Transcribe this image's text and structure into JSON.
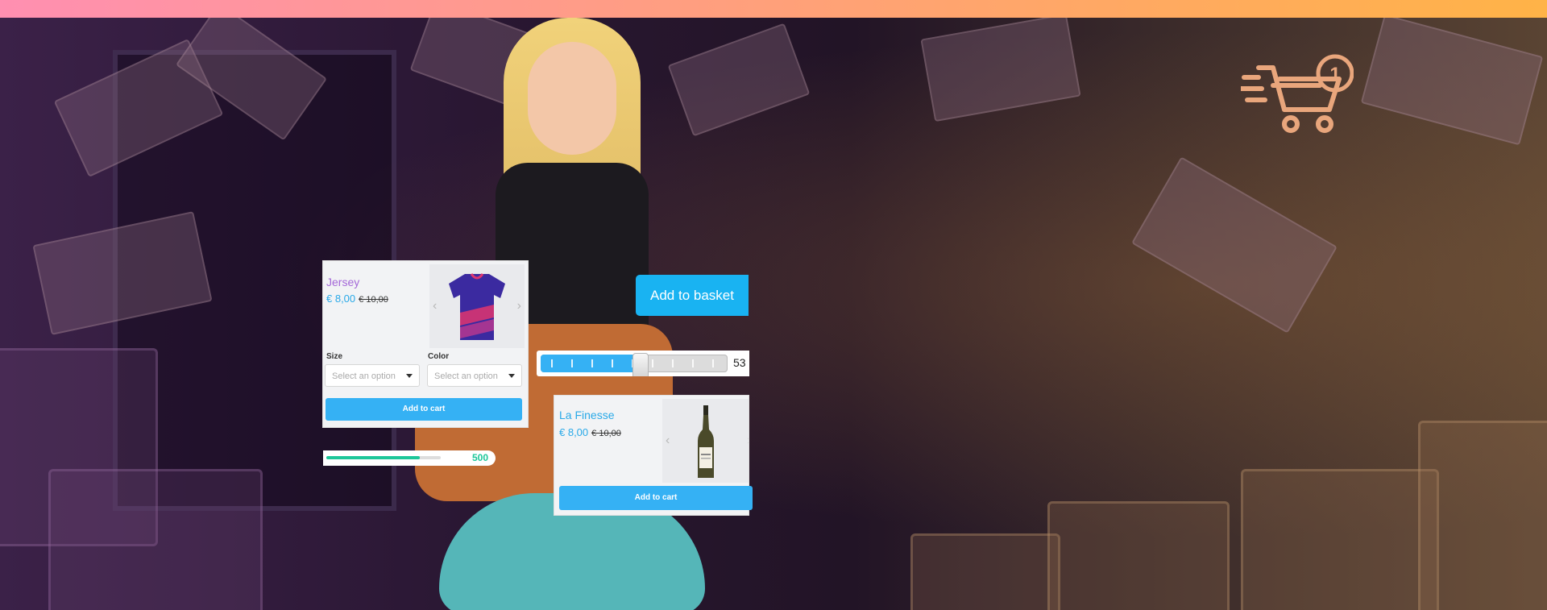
{
  "colors": {
    "top_gradient": [
      "#ff8fb1",
      "#ffb347"
    ],
    "accent": "#35b1f4",
    "progress_accent": "#1dc79a",
    "cart_icon": "#e9a67c"
  },
  "jersey_card": {
    "title": "Jersey",
    "price": "€ 8,00",
    "old_price": "€ 10,00",
    "size_label": "Size",
    "size_placeholder": "Select an option",
    "color_label": "Color",
    "color_placeholder": "Select an option",
    "add_to_cart": "Add to cart",
    "prev_icon": "chevron-left-icon",
    "next_icon": "chevron-right-icon"
  },
  "add_to_basket": {
    "label": "Add to basket"
  },
  "slider": {
    "value_text": "53",
    "fraction": 0.53
  },
  "progress": {
    "value": "500",
    "fraction": 0.82
  },
  "wine_card": {
    "title": "La Finesse",
    "price": "€ 8,00",
    "old_price": "€ 10,00",
    "add_to_cart": "Add to cart",
    "prev_icon": "chevron-left-icon",
    "next_icon": "chevron-right-icon"
  },
  "cart_badge": {
    "count": "1",
    "icon": "shopping-cart-icon"
  }
}
